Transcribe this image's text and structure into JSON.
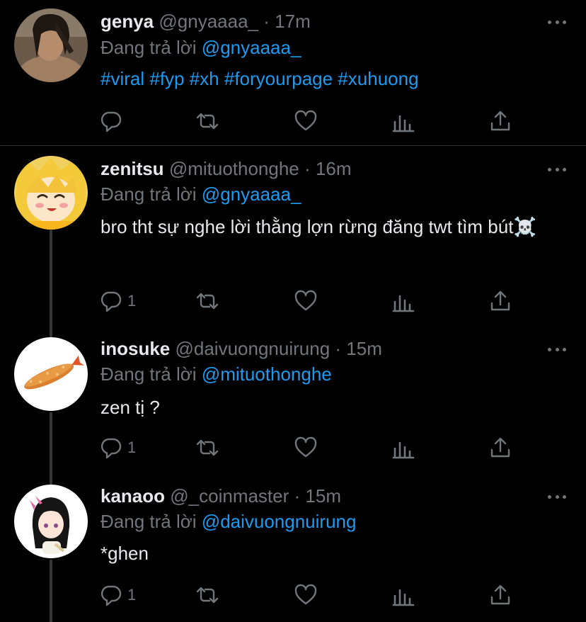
{
  "colors": {
    "background": "#000000",
    "text": "#e7e9ea",
    "muted": "#71767b",
    "link": "#1d9bf0",
    "divider": "#2f3336"
  },
  "tweets": [
    {
      "name": "genya",
      "handle": "@gnyaaaa_",
      "time": "17m",
      "replying_prefix": "Đang trả lời",
      "replying_to": "@gnyaaaa_",
      "text": "#viral #fyp #xh #foryourpage #xuhuong",
      "reply_count": "",
      "avatar": "genya-avatar"
    },
    {
      "name": "zenitsu",
      "handle": "@mituothonghe",
      "time": "16m",
      "replying_prefix": "Đang trả lời",
      "replying_to": "@gnyaaaa_",
      "text": "bro tht sự nghe lời thằng lợn rừng đăng twt tìm bút☠️",
      "reply_count": "1",
      "avatar": "zenitsu-avatar"
    },
    {
      "name": "inosuke",
      "handle": "@daivuongnuirung",
      "time": "15m",
      "replying_prefix": "Đang trả lời",
      "replying_to": "@mituothonghe",
      "text": "zen tị ?",
      "reply_count": "1",
      "avatar": "tempura-avatar"
    },
    {
      "name": "kanaoo",
      "handle": "@_coinmaster",
      "time": "15m",
      "replying_prefix": "Đang trả lời",
      "replying_to": "@daivuongnuirung",
      "text": "*ghen",
      "reply_count": "1",
      "avatar": "kanao-avatar"
    }
  ],
  "separator": "·",
  "icons": [
    "reply-icon",
    "retweet-icon",
    "like-icon",
    "analytics-icon",
    "share-icon",
    "more-icon"
  ]
}
